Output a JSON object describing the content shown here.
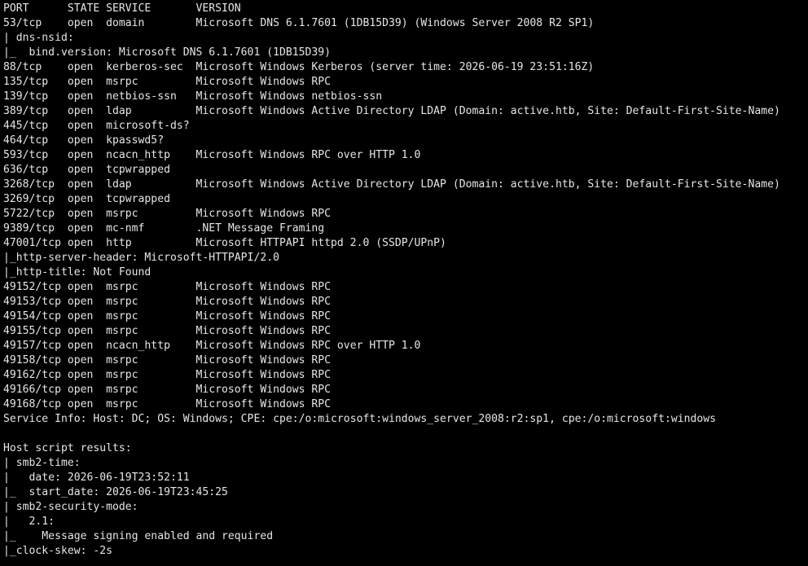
{
  "terminal": {
    "lines": [
      "PORT      STATE SERVICE       VERSION",
      "53/tcp    open  domain        Microsoft DNS 6.1.7601 (1DB15D39) (Windows Server 2008 R2 SP1)",
      "| dns-nsid: ",
      "|_  bind.version: Microsoft DNS 6.1.7601 (1DB15D39)",
      "88/tcp    open  kerberos-sec  Microsoft Windows Kerberos (server time: 2026-06-19 23:51:16Z)",
      "135/tcp   open  msrpc         Microsoft Windows RPC",
      "139/tcp   open  netbios-ssn   Microsoft Windows netbios-ssn",
      "389/tcp   open  ldap          Microsoft Windows Active Directory LDAP (Domain: active.htb, Site: Default-First-Site-Name)",
      "445/tcp   open  microsoft-ds?",
      "464/tcp   open  kpasswd5?",
      "593/tcp   open  ncacn_http    Microsoft Windows RPC over HTTP 1.0",
      "636/tcp   open  tcpwrapped",
      "3268/tcp  open  ldap          Microsoft Windows Active Directory LDAP (Domain: active.htb, Site: Default-First-Site-Name)",
      "3269/tcp  open  tcpwrapped",
      "5722/tcp  open  msrpc         Microsoft Windows RPC",
      "9389/tcp  open  mc-nmf        .NET Message Framing",
      "47001/tcp open  http          Microsoft HTTPAPI httpd 2.0 (SSDP/UPnP)",
      "|_http-server-header: Microsoft-HTTPAPI/2.0",
      "|_http-title: Not Found",
      "49152/tcp open  msrpc         Microsoft Windows RPC",
      "49153/tcp open  msrpc         Microsoft Windows RPC",
      "49154/tcp open  msrpc         Microsoft Windows RPC",
      "49155/tcp open  msrpc         Microsoft Windows RPC",
      "49157/tcp open  ncacn_http    Microsoft Windows RPC over HTTP 1.0",
      "49158/tcp open  msrpc         Microsoft Windows RPC",
      "49162/tcp open  msrpc         Microsoft Windows RPC",
      "49166/tcp open  msrpc         Microsoft Windows RPC",
      "49168/tcp open  msrpc         Microsoft Windows RPC",
      "Service Info: Host: DC; OS: Windows; CPE: cpe:/o:microsoft:windows_server_2008:r2:sp1, cpe:/o:microsoft:windows",
      "",
      "Host script results:",
      "| smb2-time: ",
      "|   date: 2026-06-19T23:52:11",
      "|_  start_date: 2026-06-19T23:45:25",
      "| smb2-security-mode: ",
      "|   2.1: ",
      "|_    Message signing enabled and required",
      "|_clock-skew: -2s"
    ]
  },
  "colors": {
    "background": "#000000",
    "text": "#e6e6e6"
  }
}
